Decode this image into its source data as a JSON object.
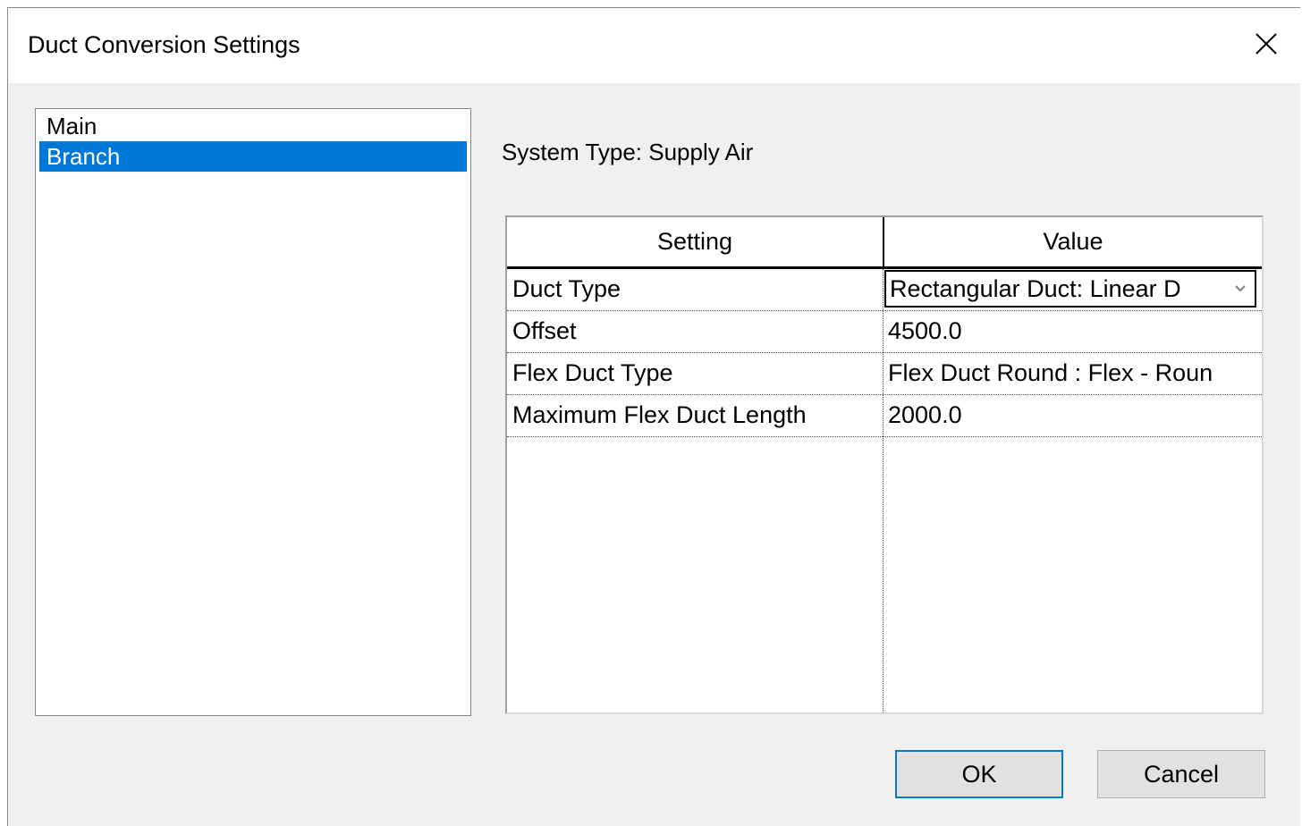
{
  "window": {
    "title": "Duct Conversion Settings",
    "close_icon": "close-icon"
  },
  "list": {
    "items": [
      "Main",
      "Branch"
    ],
    "selected": "Branch"
  },
  "system_type_label": "System Type: Supply Air",
  "grid": {
    "headers": {
      "setting": "Setting",
      "value": "Value"
    },
    "rows": [
      {
        "setting": "Duct Type",
        "value": "Rectangular Duct: Linear D"
      },
      {
        "setting": "Offset",
        "value": "4500.0"
      },
      {
        "setting": "Flex Duct Type",
        "value": "Flex Duct Round : Flex - Roun"
      },
      {
        "setting": "Maximum Flex Duct Length",
        "value": "2000.0"
      }
    ]
  },
  "buttons": {
    "ok": "OK",
    "cancel": "Cancel"
  },
  "colors": {
    "selection": "#0078d7",
    "dialog_bg": "#f0f0f0"
  }
}
